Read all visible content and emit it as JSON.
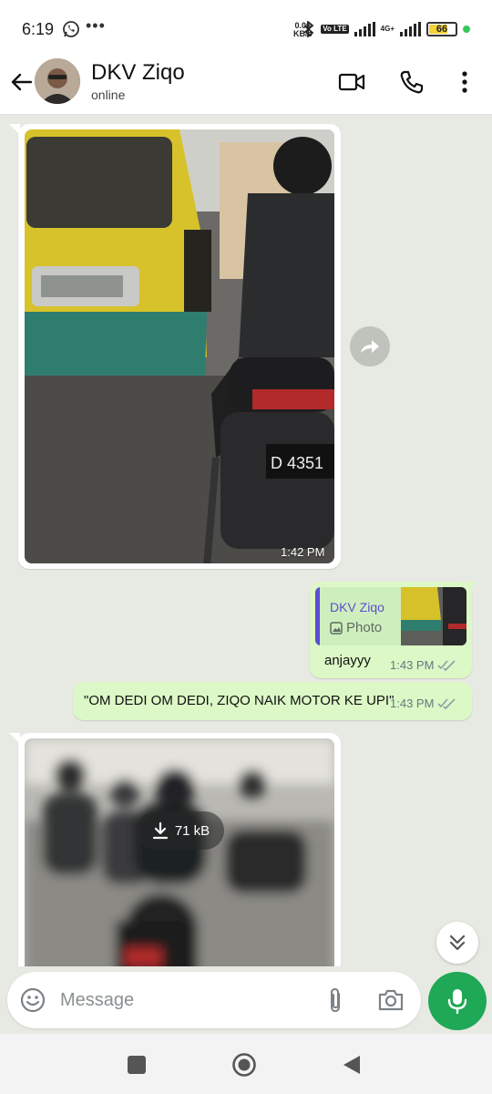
{
  "status_bar": {
    "time": "6:19",
    "net_speed_value": "0.06",
    "net_speed_unit": "KB/s",
    "volte_tag": "Vo LTE",
    "network_tag": "4G+",
    "battery_level": "66"
  },
  "header": {
    "contact_name": "DKV Ziqo",
    "contact_status": "online"
  },
  "messages": {
    "photo1_time": "1:42 PM",
    "reply_quote_name": "DKV Ziqo",
    "reply_quote_type": "Photo",
    "reply_text": "anjayyy",
    "reply_time": "1:43 PM",
    "text_msg": "\"OM DEDI OM DEDI, ZIQO NAIK MOTOR KE UPI\"",
    "text_msg_time": "1:43 PM",
    "download_size": "71 kB"
  },
  "composer": {
    "placeholder": "Message"
  },
  "colors": {
    "accent_green": "#1fa855",
    "outgoing_bubble": "#dcf8c6",
    "quote_accent": "#5a4fcf"
  }
}
